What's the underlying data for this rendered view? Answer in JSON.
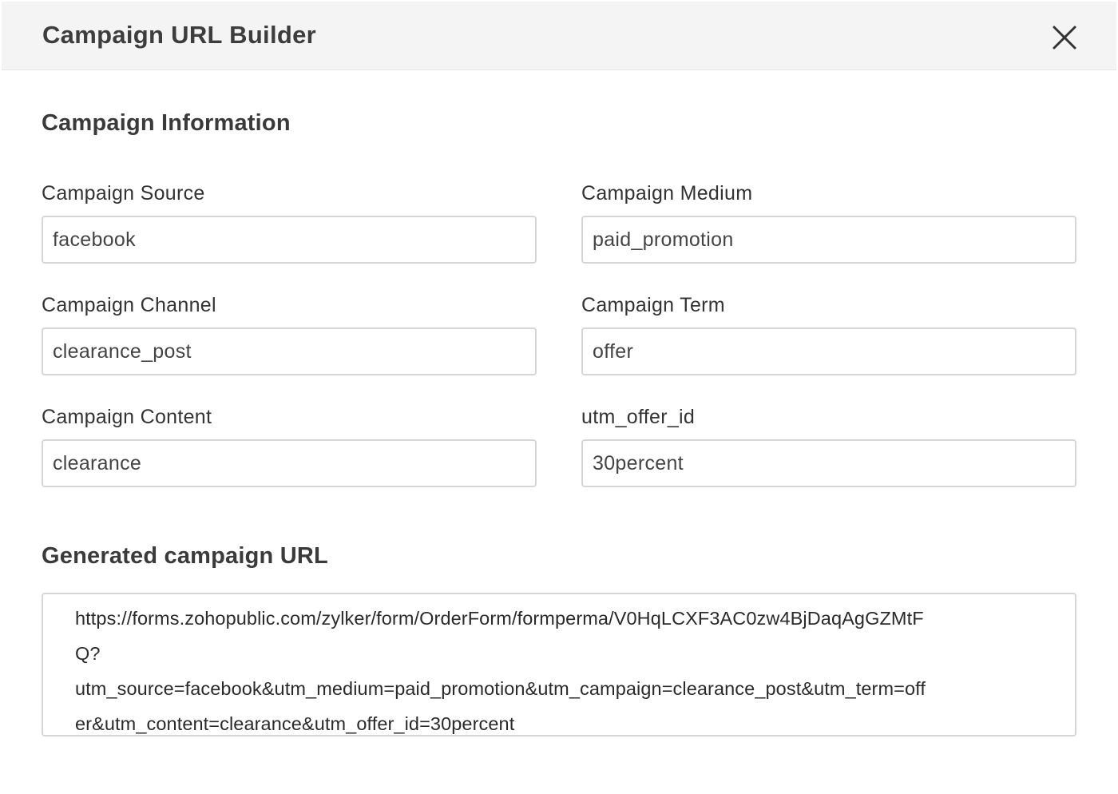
{
  "dialog": {
    "title": "Campaign URL Builder",
    "close_icon": "close-icon"
  },
  "campaign_info": {
    "heading": "Campaign Information",
    "fields": {
      "source": {
        "label": "Campaign Source",
        "value": "facebook"
      },
      "medium": {
        "label": "Campaign Medium",
        "value": "paid_promotion"
      },
      "channel": {
        "label": "Campaign Channel",
        "value": "clearance_post"
      },
      "term": {
        "label": "Campaign Term",
        "value": "offer"
      },
      "content": {
        "label": "Campaign Content",
        "value": "clearance"
      },
      "offer_id": {
        "label": "utm_offer_id",
        "value": "30percent"
      }
    }
  },
  "generated_url": {
    "heading": "Generated campaign URL",
    "lines": [
      "https://forms.zohopublic.com/zylker/form/OrderForm/formperma/V0HqLCXF3AC0zw4BjDaqAgGZMtF",
      "Q?",
      "utm_source=facebook&utm_medium=paid_promotion&utm_campaign=clearance_post&utm_term=off",
      "er&utm_content=clearance&utm_offer_id=30percent"
    ]
  }
}
